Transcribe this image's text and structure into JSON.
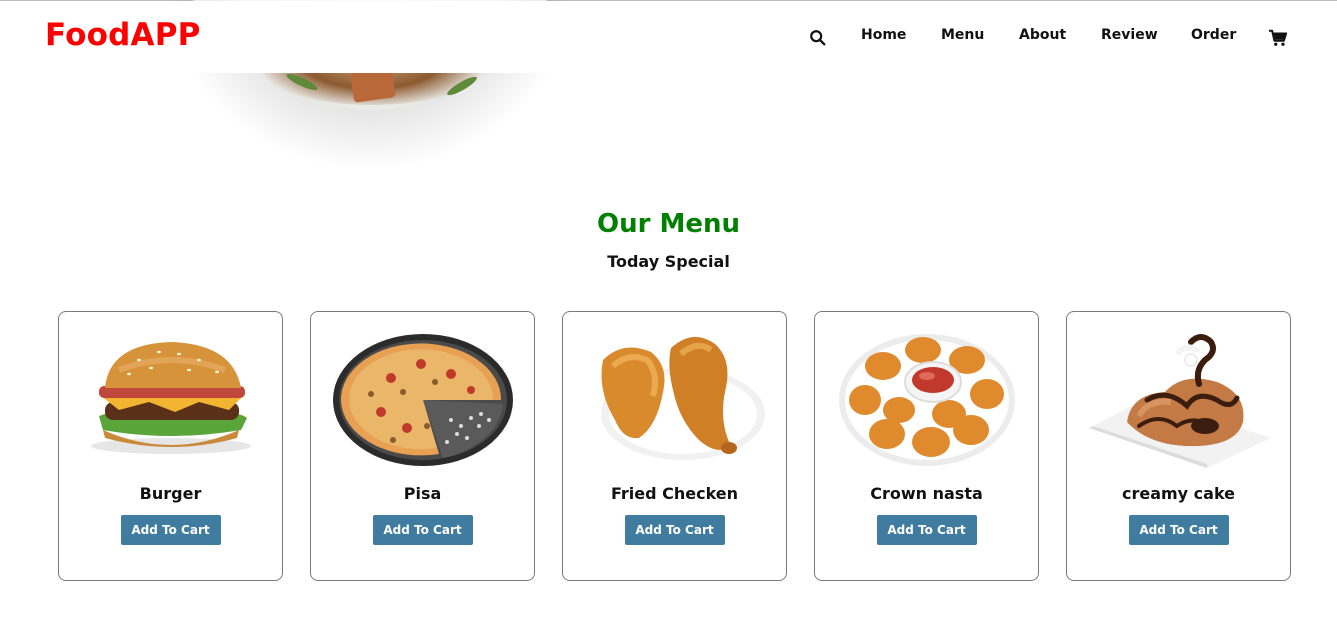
{
  "brand": {
    "logo": "FoodAPP",
    "logo_color": "#ff0000"
  },
  "nav": {
    "search_icon": "search-icon",
    "links": [
      {
        "label": "Home"
      },
      {
        "label": "Menu"
      },
      {
        "label": "About"
      },
      {
        "label": "Review"
      },
      {
        "label": "Order"
      }
    ],
    "cart_icon": "cart-icon"
  },
  "section": {
    "title": "Our Menu",
    "title_color": "#008000",
    "subtitle": "Today Special"
  },
  "items": [
    {
      "name": "Burger",
      "button": "Add To Cart",
      "image": "burger-image"
    },
    {
      "name": "Pisa",
      "button": "Add To Cart",
      "image": "pizza-image"
    },
    {
      "name": "Fried Checken",
      "button": "Add To Cart",
      "image": "fried-chicken-image"
    },
    {
      "name": "Crown nasta",
      "button": "Add To Cart",
      "image": "nuggets-image"
    },
    {
      "name": "creamy cake",
      "button": "Add To Cart",
      "image": "cake-image"
    }
  ],
  "colors": {
    "button": "#3f7ca0"
  }
}
